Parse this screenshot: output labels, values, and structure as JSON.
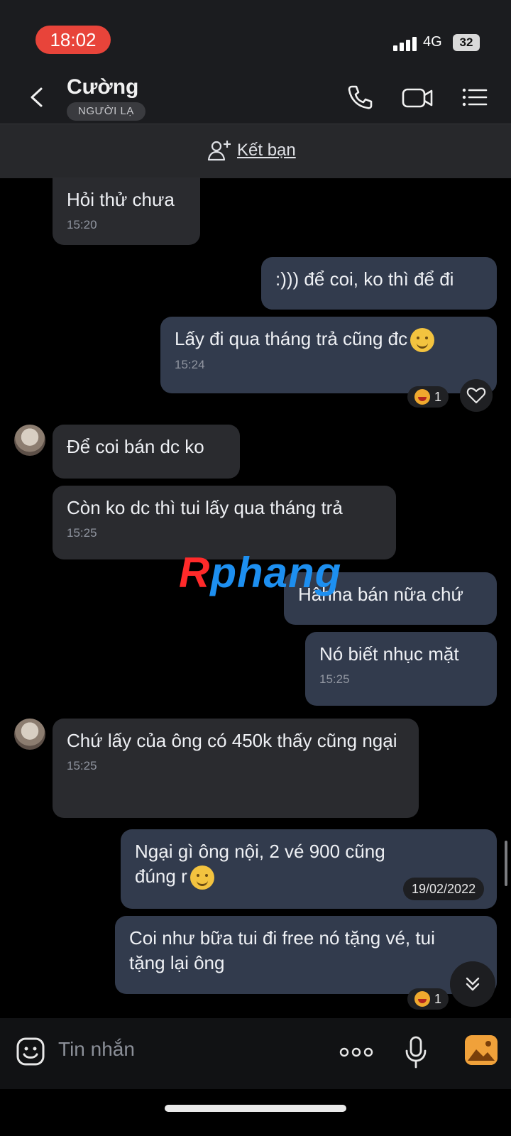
{
  "status_bar": {
    "time": "18:02",
    "network": "4G",
    "battery": "32"
  },
  "header": {
    "contact_name": "Cường",
    "badge": "NGƯỜI LẠ"
  },
  "add_friend": {
    "label": "Kết bạn"
  },
  "messages": [
    {
      "direction": "in",
      "text": "Hỏi thử chưa",
      "time": "15:20"
    },
    {
      "direction": "out",
      "text": ":))) để coi, ko thì để đi"
    },
    {
      "direction": "out",
      "text": "Lấy đi qua tháng trả cũng đc",
      "time": "15:24",
      "reaction_count": "1"
    },
    {
      "direction": "in",
      "text": "Để coi bán dc ko"
    },
    {
      "direction": "in",
      "text": "Còn ko dc thì tui lấy qua tháng trả",
      "time": "15:25"
    },
    {
      "direction": "out",
      "text": "Hâhha bán nữa chứ"
    },
    {
      "direction": "out",
      "text": "Nó biết nhục mặt",
      "time": "15:25"
    },
    {
      "direction": "in",
      "text": "Chứ lấy của ông có 450k thấy cũng ngại",
      "time": "15:25"
    },
    {
      "direction": "out",
      "text": "Ngại gì ông nội, 2 vé 900 cũng đúng r"
    },
    {
      "direction": "out",
      "text": "Coi như bữa tui đi free nó tặng vé, tui tặng lại ông",
      "reaction_count": "1"
    }
  ],
  "date_chip": "19/02/2022",
  "watermark": {
    "first": "R",
    "rest": "phang"
  },
  "input": {
    "placeholder": "Tin nhắn"
  },
  "colors": {
    "incoming_bubble": "#2a2b2f",
    "outgoing_bubble": "#323b4d",
    "time_pill": "#e8443a",
    "accent": "#f0a13a"
  },
  "icons": [
    "back-icon",
    "phone-icon",
    "video-call-icon",
    "menu-list-icon",
    "add-friend-icon",
    "heart-icon",
    "chevron-double-down-icon",
    "sticker-icon",
    "more-dots-icon",
    "microphone-icon",
    "image-icon"
  ]
}
